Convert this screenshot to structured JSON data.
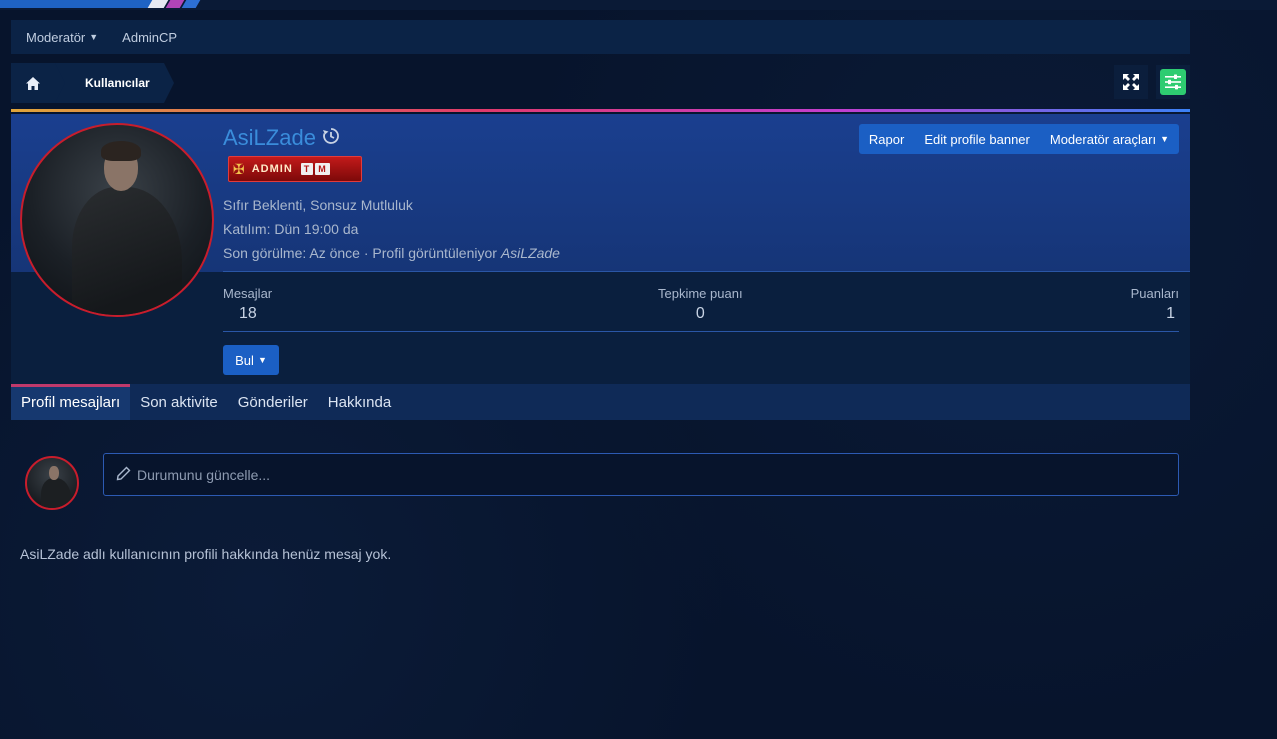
{
  "subnav": {
    "items": [
      {
        "label": "Moderatör",
        "has_caret": true
      },
      {
        "label": "AdminCP",
        "has_caret": false
      }
    ]
  },
  "breadcrumb": {
    "home_icon": "home-icon",
    "items": [
      {
        "label": "Kullanıcılar"
      }
    ]
  },
  "toolbar": {
    "fullscreen_icon": "fullscreen-icon",
    "settings_icon": "sliders-icon",
    "settings_color": "#2ecc71"
  },
  "profile": {
    "username": "AsiLZade",
    "username_color": "#3a8ddb",
    "badge": {
      "label": "ADMIN",
      "suffix1": "T",
      "suffix2": "M"
    },
    "about_line": "Sıfır Beklenti, Sonsuz Mutluluk",
    "joined": "Katılım: Dün 19:00 da",
    "last_seen_prefix": "Son görülme: Az önce · Profil görüntüleniyor",
    "last_seen_user": "AsiLZade",
    "actions": {
      "report": "Rapor",
      "edit_banner": "Edit profile banner",
      "mod_tools": "Moderatör araçları"
    },
    "stats": [
      {
        "label": "Mesajlar",
        "value": "18"
      },
      {
        "label": "Tepkime puanı",
        "value": "0"
      },
      {
        "label": "Puanları",
        "value": "1"
      }
    ],
    "find_button": "Bul"
  },
  "tabs": [
    {
      "label": "Profil mesajları",
      "active": true
    },
    {
      "label": "Son aktivite",
      "active": false
    },
    {
      "label": "Gönderiler",
      "active": false
    },
    {
      "label": "Hakkında",
      "active": false
    }
  ],
  "status": {
    "placeholder": "Durumunu güncelle..."
  },
  "empty_message": "AsiLZade adlı kullanıcının profili hakkında henüz mesaj yok."
}
